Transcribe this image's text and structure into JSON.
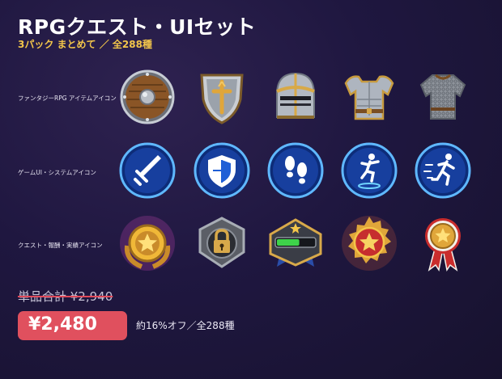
{
  "header": {
    "title": "RPGクエスト・UIセット",
    "subtitle": "3パック まとめて ／ 全288種"
  },
  "rows": [
    {
      "label": "ファンタジーRPG アイテムアイコン",
      "icons": [
        "round-wooden-shield-icon",
        "kite-shield-icon",
        "knight-helmet-icon",
        "plate-armor-icon",
        "chainmail-shirt-icon"
      ]
    },
    {
      "label": "ゲームUI・システムアイコン",
      "icons": [
        "sword-attack-icon",
        "shield-defense-icon",
        "footsteps-icon",
        "jump-action-icon",
        "run-sprint-icon"
      ]
    },
    {
      "label": "クエスト・報酬・実績アイコン",
      "icons": [
        "gold-star-medal-icon",
        "padlock-badge-icon",
        "progress-bar-emblem-icon",
        "red-star-medal-icon",
        "ribbon-rosette-icon"
      ]
    }
  ],
  "pricing": {
    "original": "単品合計 ¥2,940",
    "sale": "¥2,480",
    "discount_note": "約16%オフ／全288種"
  },
  "colors": {
    "accent_gold": "#f3c64a",
    "sale_red": "#e0505e",
    "background": "#1f1740",
    "ui_icon_blue": "#1f5fd6"
  },
  "progress_bar_level": 0.6
}
